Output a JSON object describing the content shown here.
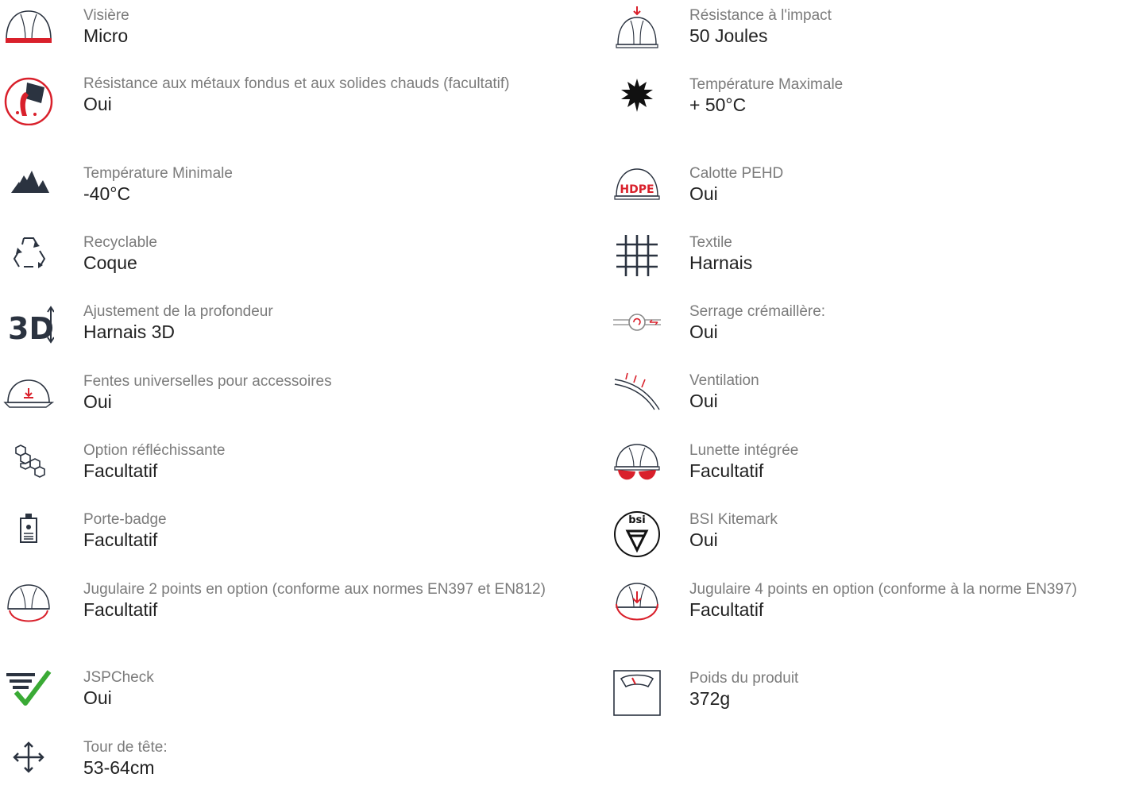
{
  "colors": {
    "accent": "#d9202b",
    "check": "#3aaa35",
    "label": "#7b7b7b",
    "value": "#222222",
    "icon": "#2b3340"
  },
  "left_features": [
    {
      "icon": "helmet-visor-icon",
      "label": "Visière",
      "value": "Micro"
    },
    {
      "icon": "molten-metal-icon",
      "label": "Résistance aux métaux fondus et aux solides chauds (facultatif)",
      "value": "Oui"
    },
    {
      "icon": "mountains-icon",
      "label": "Température Minimale",
      "value": "-40°C"
    },
    {
      "icon": "recycle-icon",
      "label": "Recyclable",
      "value": "Coque"
    },
    {
      "icon": "3d-depth-icon",
      "label": "Ajustement de la profondeur",
      "value": "Harnais 3D"
    },
    {
      "icon": "helmet-slot-icon",
      "label": "Fentes universelles pour accessoires",
      "value": "Oui"
    },
    {
      "icon": "hexagons-icon",
      "label": "Option réfléchissante",
      "value": "Facultatif"
    },
    {
      "icon": "badge-holder-icon",
      "label": "Porte-badge",
      "value": "Facultatif"
    },
    {
      "icon": "helmet-chinstrap-2-icon",
      "label": "Jugulaire 2 points en option (conforme aux normes EN397 et EN812)",
      "value": "Facultatif"
    },
    {
      "icon": "jspcheck-icon",
      "label": "JSPCheck",
      "value": "Oui"
    },
    {
      "icon": "move-arrows-icon",
      "label": "Tour de tête:",
      "value": "53-64cm"
    }
  ],
  "right_features": [
    {
      "icon": "helmet-impact-icon",
      "label": "Résistance à l'impact",
      "value": "50 Joules"
    },
    {
      "icon": "sun-icon",
      "label": "Température Maximale",
      "value": "+ 50°C"
    },
    {
      "icon": "hdpe-helmet-icon",
      "label": "Calotte PEHD",
      "value": "Oui",
      "icon_text": "HDPE"
    },
    {
      "icon": "textile-icon",
      "label": "Textile",
      "value": "Harnais"
    },
    {
      "icon": "ratchet-icon",
      "label": "Serrage crémaillère:",
      "value": "Oui"
    },
    {
      "icon": "ventilation-icon",
      "label": "Ventilation",
      "value": "Oui"
    },
    {
      "icon": "helmet-glasses-icon",
      "label": "Lunette intégrée",
      "value": "Facultatif"
    },
    {
      "icon": "bsi-kitemark-icon",
      "label": "BSI Kitemark",
      "value": "Oui",
      "icon_text": "bsi"
    },
    {
      "icon": "helmet-chinstrap-4-icon",
      "label": "Jugulaire 4 points en option (conforme à la norme EN397)",
      "value": "Facultatif"
    },
    {
      "icon": "scale-icon",
      "label": "Poids du produit",
      "value": "372g"
    }
  ]
}
